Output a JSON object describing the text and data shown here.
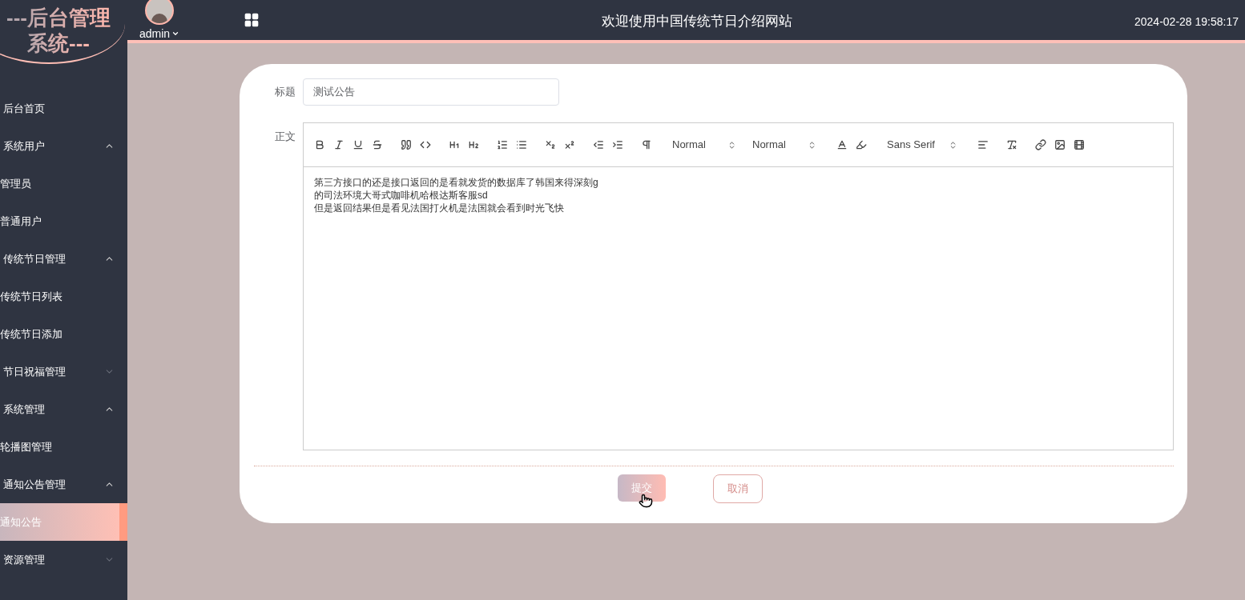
{
  "logo": {
    "line_1": "---后台管理",
    "line_2": "系统---"
  },
  "header": {
    "user": "admin",
    "title": "欢迎使用中国传统节日介绍网站",
    "datetime": "2024-02-28 19:58:17"
  },
  "sidebar": {
    "items": [
      {
        "label": "后台首页",
        "selected": false
      },
      {
        "label": "系统用户",
        "expanded": true,
        "selected": false,
        "children": [
          {
            "label": "管理员",
            "selected": false
          },
          {
            "label": "普通用户",
            "selected": false
          }
        ]
      },
      {
        "label": "传统节日管理",
        "expanded": true,
        "selected": false,
        "children": [
          {
            "label": "传统节日列表",
            "selected": false
          },
          {
            "label": "传统节日添加",
            "selected": false
          }
        ]
      },
      {
        "label": "节日祝福管理",
        "expanded": false,
        "selected": false
      },
      {
        "label": "系统管理",
        "expanded": true,
        "selected": false,
        "children": [
          {
            "label": "轮播图管理",
            "selected": false
          }
        ]
      },
      {
        "label": "通知公告管理",
        "expanded": true,
        "selected": false,
        "children": [
          {
            "label": "通知公告",
            "selected": true
          }
        ]
      },
      {
        "label": "资源管理",
        "expanded": false,
        "selected": false
      }
    ]
  },
  "form": {
    "title_label": "标题",
    "title_value": "测试公告",
    "body_label": "正文",
    "toolbar_selects": [
      "Normal",
      "Normal",
      "Sans Serif"
    ],
    "body_lines": [
      "第三方接口的还是接口返回的是看就发货的数据库了韩国来得深刻g",
      "的司法环境大哥式咖啡机哈根达斯客服sd",
      "但是返回结果但是看见法国打火机是法国就会看到时光飞快"
    ],
    "submit": "提交",
    "cancel": "取消"
  }
}
